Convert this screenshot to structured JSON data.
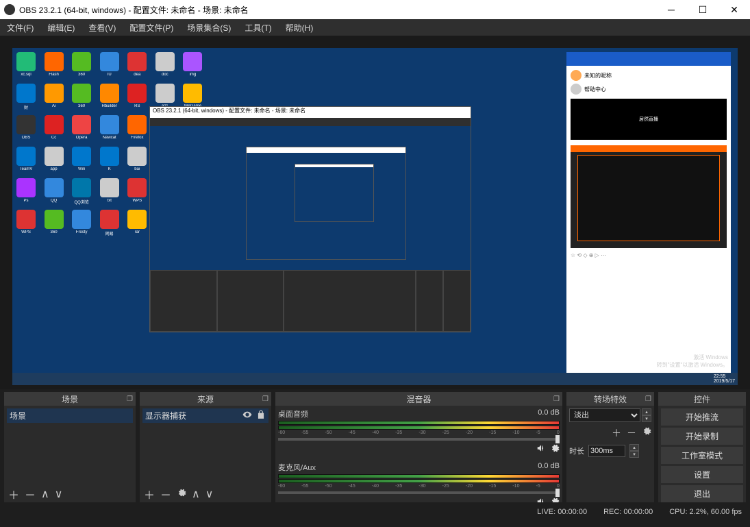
{
  "titlebar": {
    "text": "OBS 23.2.1 (64-bit, windows) - 配置文件: 未命名 - 场景: 未命名"
  },
  "menu": {
    "file": "文件(F)",
    "edit": "编辑(E)",
    "view": "查看(V)",
    "profile": "配置文件(P)",
    "scene_collection": "场景集合(S)",
    "tools": "工具(T)",
    "help": "帮助(H)"
  },
  "preview": {
    "watermark_line1": "激活 Windows",
    "watermark_line2": "转到\"设置\"以激活 Windows。",
    "taskbar_time": "22:55",
    "taskbar_date": "2019/5/17",
    "recursive_title": "OBS 23.2.1 (64-bit, windows) - 配置文件: 未命名 - 场景: 未命名"
  },
  "panels": {
    "scenes": {
      "title": "场景",
      "items": [
        "场景"
      ]
    },
    "sources": {
      "title": "来源",
      "items": [
        "显示器捕获"
      ]
    },
    "mixer": {
      "title": "混音器",
      "channels": [
        {
          "name": "桌面音频",
          "db": "0.0 dB"
        },
        {
          "name": "麦克风/Aux",
          "db": "0.0 dB"
        }
      ],
      "ticks": [
        "-60",
        "-55",
        "-50",
        "-45",
        "-40",
        "-35",
        "-30",
        "-25",
        "-20",
        "-15",
        "-10",
        "-5",
        "0"
      ]
    },
    "transitions": {
      "title": "转场特效",
      "selected": "淡出",
      "duration_label": "时长",
      "duration_value": "300ms"
    },
    "controls": {
      "title": "控件",
      "buttons": [
        "开始推流",
        "开始录制",
        "工作室模式",
        "设置",
        "退出"
      ]
    }
  },
  "statusbar": {
    "live": "LIVE: 00:00:00",
    "rec": "REC: 00:00:00",
    "cpu": "CPU: 2.2%, 60.00 fps"
  }
}
